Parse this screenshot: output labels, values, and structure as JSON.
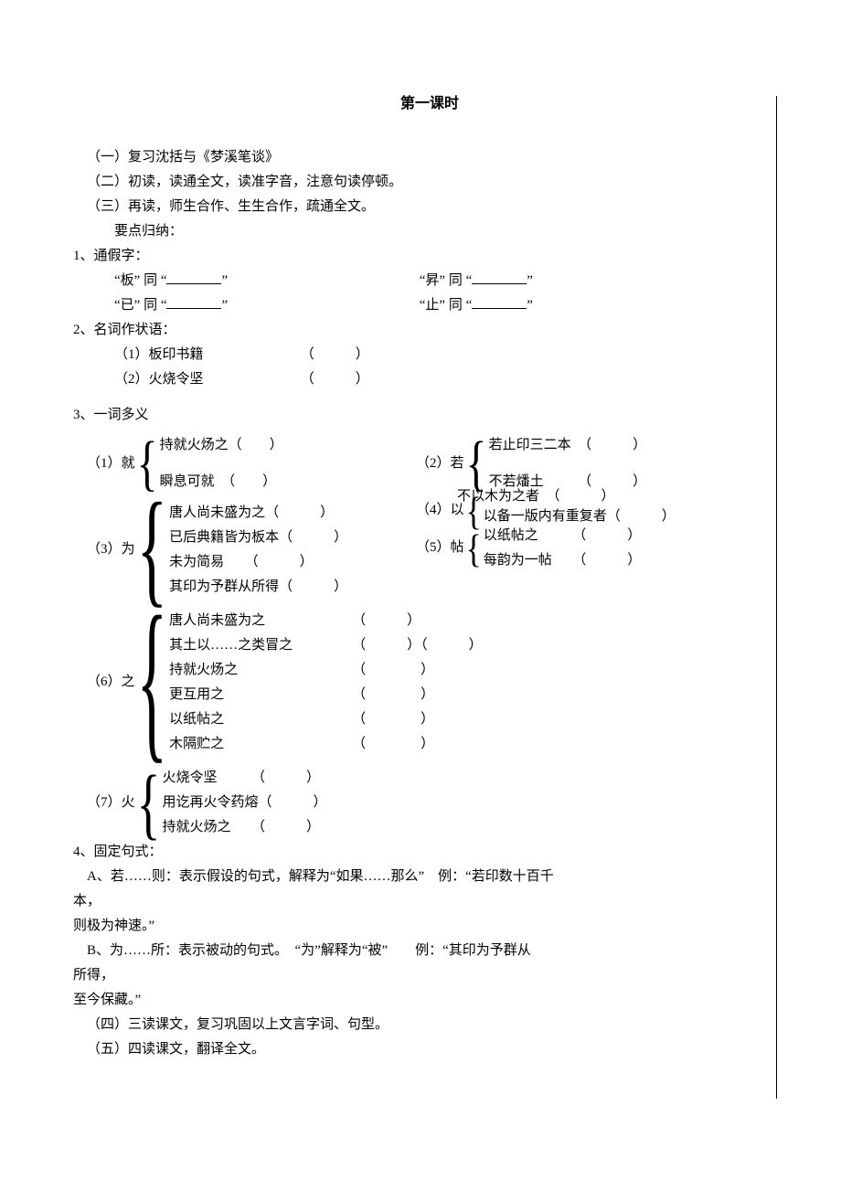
{
  "title": "第一课时",
  "sec1": "（一）复习沈括与《梦溪笔谈》",
  "sec2": "（二）初读，读通全文，读准字音，注意句读停顿。",
  "sec3": "（三）再读，师生合作、生生合作，疏通全文。",
  "keypoints": "要点归纳：",
  "p1_title": "1、通假字：",
  "tongjia": {
    "a1": "“板” 同 “",
    "a2": "”",
    "b1": "“昇” 同 “",
    "b2": "”",
    "c1": "“已” 同 “",
    "c2": "”",
    "d1": "“止” 同 “",
    "d2": "”"
  },
  "p2_title": "2、名词作状语：",
  "p2_1": "（1）板印书籍",
  "p2_2": "（2）火烧令坚",
  "p3_title": "3、一词多义",
  "g1_label": "（1）就",
  "g1_items": [
    "持就火炀之（　　）",
    "瞬息可就　（　　）"
  ],
  "g2_label": "（2）若",
  "g2_items": [
    "若止印三二本　（　　　）",
    "不若燔土　　　（　　　）"
  ],
  "g3_label": "（3）为",
  "g3_items": [
    "唐人尚未盛为之（　　　）",
    "已后典籍皆为板本（　　　）",
    "未为简易　　（　　　）",
    "其印为予群从所得（　　　）"
  ],
  "g4_label": "（4）以",
  "g4_pre": "不以木为之者　（　　　）",
  "g4_items": [
    "以备一版内有重复者（　　　）"
  ],
  "g5_label": "（5）帖",
  "g5_items": [
    "以纸帖之　　　（　　　）",
    "每韵为一帖　　（　　　）"
  ],
  "g6_label": "（6）之",
  "g6_items": [
    {
      "t": "唐人尚未盛为之",
      "p": "（　　　）"
    },
    {
      "t": "其土以……之类冒之",
      "p": "（　　　）（　　　）"
    },
    {
      "t": "持就火炀之",
      "p": "（　　　　）"
    },
    {
      "t": "更互用之",
      "p": "（　　　　）"
    },
    {
      "t": "以纸帖之",
      "p": "（　　　　）"
    },
    {
      "t": "木隔贮之",
      "p": "（　　　　）"
    }
  ],
  "g7_label": "（7）火",
  "g7_items": [
    "火烧令坚　　　（　　　）",
    "用讫再火令药熔（　　　）",
    "持就火炀之　　（　　　）"
  ],
  "p4_title": "4、固定句式：",
  "p4_a1": "A、若……则：表示假设的句式，解释为“如果……那么”　例：“若印数十百千",
  "p4_a2": "本，",
  "p4_a3": "则极为神速。”",
  "p4_b1": "B、为……所：表示被动的句式。　“为”解释为“被”　　例：“其印为予群从",
  "p4_b2": "所得，",
  "p4_b3": "至今保藏。”",
  "sec4": "（四）三读课文，复习巩固以上文言字词、句型。",
  "sec5": "（五）四读课文，翻译全文。"
}
